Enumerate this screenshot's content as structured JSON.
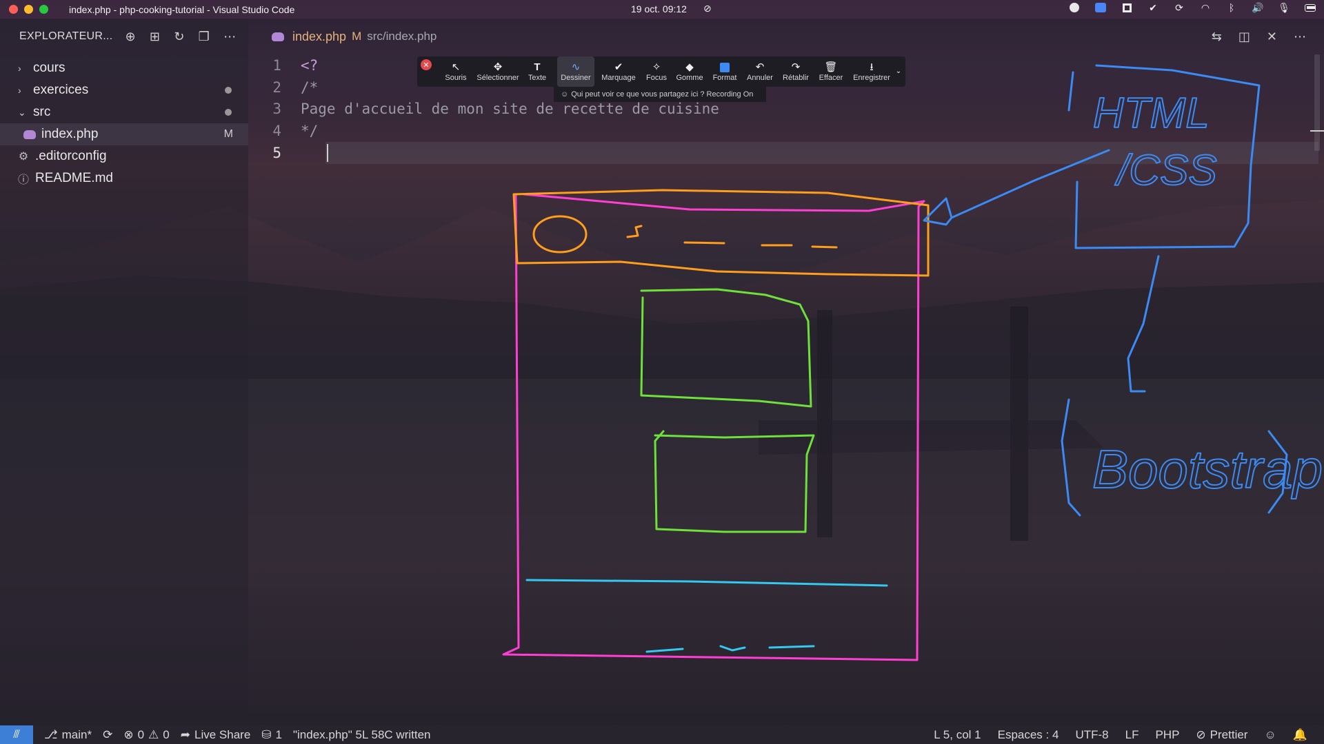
{
  "window": {
    "title": "index.php - php-cooking-tutorial - Visual Studio Code",
    "clock": "19 oct.  09:12"
  },
  "sidebar": {
    "header": "EXPLORATEUR...",
    "items": [
      {
        "label": "cours",
        "kind": "folder",
        "state": "collapsed"
      },
      {
        "label": "exercices",
        "kind": "folder",
        "state": "collapsed",
        "decoration": "dot"
      },
      {
        "label": "src",
        "kind": "folder",
        "state": "expanded",
        "decoration": "dot"
      },
      {
        "label": "index.php",
        "kind": "file",
        "icon": "php-icon",
        "decoration": "M"
      },
      {
        "label": ".editorconfig",
        "kind": "file",
        "icon": "gear-icon"
      },
      {
        "label": "README.md",
        "kind": "file",
        "icon": "info-icon"
      }
    ]
  },
  "tab": {
    "name": "index.php",
    "status": "M",
    "path": "src/index.php"
  },
  "code": {
    "lines": [
      {
        "n": "1",
        "text": "<?"
      },
      {
        "n": "2",
        "text": "/*"
      },
      {
        "n": "3",
        "text": "Page d'accueil de mon site de recette de cuisine"
      },
      {
        "n": "4",
        "text": "*/"
      },
      {
        "n": "5",
        "text": ""
      }
    ]
  },
  "annotate": {
    "tools": [
      {
        "label": "Souris",
        "glyph": "arrow-icon"
      },
      {
        "label": "Sélectionner",
        "glyph": "move-icon"
      },
      {
        "label": "Texte",
        "glyph": "text-icon"
      },
      {
        "label": "Dessiner",
        "glyph": "draw-icon",
        "active": true
      },
      {
        "label": "Marquage",
        "glyph": "check-icon"
      },
      {
        "label": "Focus",
        "glyph": "spotlight-icon"
      },
      {
        "label": "Gomme",
        "glyph": "eraser-icon"
      },
      {
        "label": "Format",
        "glyph": "color-square-icon",
        "color": "#3d8bf2"
      },
      {
        "label": "Annuler",
        "glyph": "undo-icon"
      },
      {
        "label": "Rétablir",
        "glyph": "redo-icon"
      },
      {
        "label": "Effacer",
        "glyph": "trash-icon"
      },
      {
        "label": "Enregistrer",
        "glyph": "save-icon"
      }
    ],
    "note": "Qui peut voir ce que vous partagez ici ? Recording On"
  },
  "sketch": {
    "labels": [
      "HTML",
      "/CSS",
      "Bootstrap"
    ]
  },
  "status": {
    "branch": "main*",
    "errors": "0",
    "warnings": "0",
    "live_share": "Live Share",
    "ports": "1",
    "message": "\"index.php\" 5L 58C written",
    "position": "L 5, col 1",
    "indent": "Espaces : 4",
    "encoding": "UTF-8",
    "eol": "LF",
    "language": "PHP",
    "formatter": "Prettier"
  },
  "colors": {
    "accent": "#3d7fd6",
    "modified": "#e8b17a",
    "sketch_pink": "#ff3fd4",
    "sketch_orange": "#ff9d1c",
    "sketch_green": "#6ee23a",
    "sketch_cyan": "#34c9f0",
    "sketch_blue": "#3b8bf5"
  }
}
